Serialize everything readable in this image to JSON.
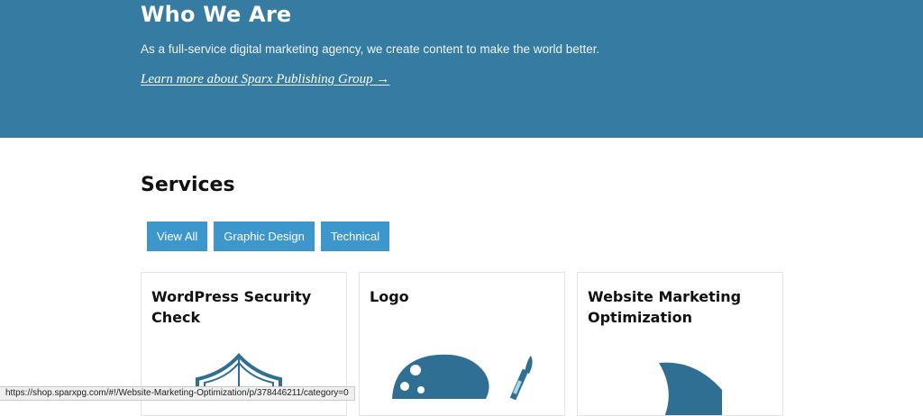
{
  "hero": {
    "title": "Who We Are",
    "description": "As a full-service digital marketing agency, we create content to make the world better.",
    "link_text": "Learn more about Sparx Publishing Group →"
  },
  "services": {
    "title": "Services",
    "filters": [
      "View All",
      "Graphic Design",
      "Technical"
    ],
    "cards": [
      {
        "title": "WordPress Security Check",
        "icon": "security-shield-icon"
      },
      {
        "title": "Logo",
        "icon": "paint-palette-icon"
      },
      {
        "title": "Website Marketing Optimization",
        "icon": "shark-fin-icon"
      }
    ]
  },
  "status_bar": {
    "url": "https://shop.sparxpg.com/#!/Website-Marketing-Optimization/p/378446211/category=0"
  },
  "colors": {
    "hero_bg": "#367ca2",
    "button_bg": "#3d97cc",
    "icon_blue": "#2f6f94"
  }
}
